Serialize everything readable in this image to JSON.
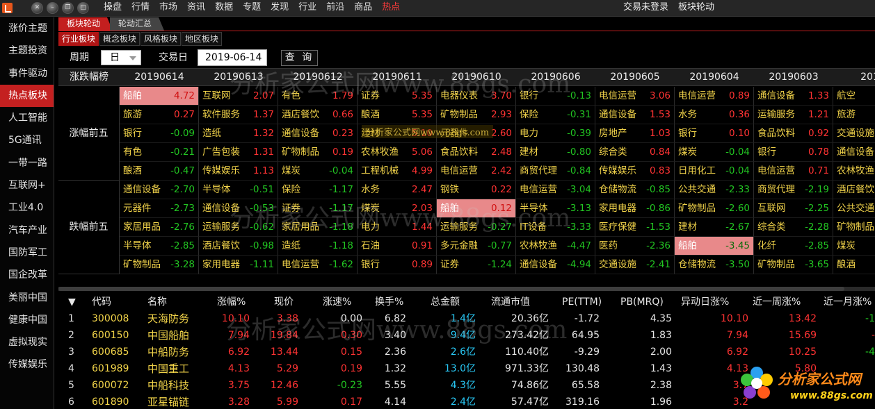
{
  "topbar": {
    "menu": [
      "操盘",
      "行情",
      "市场",
      "资讯",
      "数据",
      "专题",
      "发现",
      "行业",
      "前沿",
      "商品",
      "热点"
    ],
    "active_menu": "热点",
    "login_status": "交易未登录",
    "window_title": "板块轮动",
    "window_controls": [
      "close-icon",
      "minimize-icon",
      "restore-icon",
      "maximize-icon"
    ]
  },
  "sidebar": {
    "items": [
      "涨价主题",
      "主题投资",
      "事件驱动",
      "热点板块",
      "人工智能",
      "5G通讯",
      "一带一路",
      "互联网+",
      "工业4.0",
      "汽车产业",
      "国防军工",
      "国企改革",
      "美丽中国",
      "健康中国",
      "虚拟现实",
      "传媒娱乐"
    ],
    "active": "热点板块"
  },
  "tabs_primary": [
    "板块轮动",
    "轮动汇总"
  ],
  "tabs_secondary": [
    "行业板块",
    "概念板块",
    "风格板块",
    "地区板块"
  ],
  "filters": {
    "period_label": "周期",
    "period_value": "日",
    "date_label": "交易日",
    "date_value": "2019-06-14",
    "query_label": "查 询"
  },
  "rotation": {
    "header_label": "涨跌幅榜",
    "dates": [
      "20190614",
      "20190613",
      "20190612",
      "20190611",
      "20190610",
      "20190606",
      "20190605",
      "20190604",
      "20190603",
      "2019"
    ],
    "groups": [
      "涨幅前五",
      "跌幅前五"
    ],
    "highlight_name": "船舶",
    "rows": [
      [
        [
          "船舶",
          "4.72"
        ],
        [
          "互联网",
          "2.07"
        ],
        [
          "有色",
          "1.79"
        ],
        [
          "证券",
          "5.35"
        ],
        [
          "电器仪表",
          "3.70"
        ],
        [
          "银行",
          "-0.13"
        ],
        [
          "电信运营",
          "3.06"
        ],
        [
          "电信运营",
          "0.89"
        ],
        [
          "通信设备",
          "1.33"
        ],
        [
          "航空",
          ""
        ]
      ],
      [
        [
          "旅游",
          "0.27"
        ],
        [
          "软件服务",
          "1.37"
        ],
        [
          "酒店餐饮",
          "0.66"
        ],
        [
          "酿酒",
          "5.35"
        ],
        [
          "矿物制品",
          "2.93"
        ],
        [
          "保险",
          "-0.31"
        ],
        [
          "通信设备",
          "1.53"
        ],
        [
          "水务",
          "0.36"
        ],
        [
          "运输服务",
          "1.21"
        ],
        [
          "旅游",
          ""
        ]
      ],
      [
        [
          "银行",
          "-0.09"
        ],
        [
          "造纸",
          "1.32"
        ],
        [
          "通信设备",
          "0.23"
        ],
        [
          "建材",
          "5.10"
        ],
        [
          "元器件",
          "2.60"
        ],
        [
          "电力",
          "-0.39"
        ],
        [
          "房地产",
          "1.03"
        ],
        [
          "银行",
          "0.10"
        ],
        [
          "食品饮料",
          "0.92"
        ],
        [
          "交通设施",
          ""
        ]
      ],
      [
        [
          "有色",
          "-0.21"
        ],
        [
          "广告包装",
          "1.31"
        ],
        [
          "矿物制品",
          "0.19"
        ],
        [
          "农林牧渔",
          "5.06"
        ],
        [
          "食品饮料",
          "2.48"
        ],
        [
          "建材",
          "-0.80"
        ],
        [
          "综合类",
          "0.84"
        ],
        [
          "煤炭",
          "-0.04"
        ],
        [
          "银行",
          "0.78"
        ],
        [
          "通信设备",
          ""
        ]
      ],
      [
        [
          "酿酒",
          "-0.47"
        ],
        [
          "传媒娱乐",
          "1.13"
        ],
        [
          "煤炭",
          "-0.04"
        ],
        [
          "工程机械",
          "4.99"
        ],
        [
          "电信运营",
          "2.42"
        ],
        [
          "商贸代理",
          "-0.84"
        ],
        [
          "传媒娱乐",
          "0.83"
        ],
        [
          "日用化工",
          "-0.04"
        ],
        [
          "电信运营",
          "0.71"
        ],
        [
          "农林牧渔",
          ""
        ]
      ],
      [
        [
          "通信设备",
          "-2.70"
        ],
        [
          "半导体",
          "-0.51"
        ],
        [
          "保险",
          "-1.17"
        ],
        [
          "水务",
          "2.47"
        ],
        [
          "钢铁",
          "0.22"
        ],
        [
          "电信运营",
          "-3.04"
        ],
        [
          "仓储物流",
          "-0.85"
        ],
        [
          "公共交通",
          "-2.33"
        ],
        [
          "商贸代理",
          "-2.19"
        ],
        [
          "酒店餐饮",
          ""
        ]
      ],
      [
        [
          "元器件",
          "-2.73"
        ],
        [
          "通信设备",
          "-0.53"
        ],
        [
          "证券",
          "-1.17"
        ],
        [
          "煤炭",
          "2.03"
        ],
        [
          "船舶",
          "0.12"
        ],
        [
          "半导体",
          "-3.13"
        ],
        [
          "家用电器",
          "-0.86"
        ],
        [
          "矿物制品",
          "-2.60"
        ],
        [
          "互联网",
          "-2.25"
        ],
        [
          "公共交通",
          ""
        ]
      ],
      [
        [
          "家居用品",
          "-2.76"
        ],
        [
          "运输服务",
          "-0.62"
        ],
        [
          "家居用品",
          "-1.18"
        ],
        [
          "电力",
          "1.44"
        ],
        [
          "运输服务",
          "-0.27"
        ],
        [
          "IT设备",
          "-3.33"
        ],
        [
          "医疗保健",
          "-1.53"
        ],
        [
          "建材",
          "-2.67"
        ],
        [
          "综合类",
          "-2.28"
        ],
        [
          "矿物制品",
          ""
        ]
      ],
      [
        [
          "半导体",
          "-2.85"
        ],
        [
          "酒店餐饮",
          "-0.98"
        ],
        [
          "造纸",
          "-1.18"
        ],
        [
          "石油",
          "0.91"
        ],
        [
          "多元金融",
          "-0.77"
        ],
        [
          "农林牧渔",
          "-4.47"
        ],
        [
          "医药",
          "-2.36"
        ],
        [
          "船舶",
          "-3.45"
        ],
        [
          "化纤",
          "-2.85"
        ],
        [
          "煤炭",
          ""
        ]
      ],
      [
        [
          "矿物制品",
          "-3.28"
        ],
        [
          "家用电器",
          "-1.11"
        ],
        [
          "电信运营",
          "-1.62"
        ],
        [
          "银行",
          "0.89"
        ],
        [
          "证券",
          "-1.24"
        ],
        [
          "通信设备",
          "-4.94"
        ],
        [
          "交通设施",
          "-2.41"
        ],
        [
          "仓储物流",
          "-3.50"
        ],
        [
          "矿物制品",
          "-3.65"
        ],
        [
          "酿酒",
          ""
        ]
      ]
    ]
  },
  "stock_table": {
    "columns": [
      "代码",
      "名称",
      "涨幅%",
      "现价",
      "涨速%",
      "换手%",
      "总金额",
      "流通市值",
      "PE(TTM)",
      "PB(MRQ)",
      "异动日涨%",
      "近一周涨%",
      "近一月涨%"
    ],
    "rows": [
      [
        "1",
        "300008",
        "天海防务",
        "10.10",
        "3.38",
        "0.00",
        "6.82",
        "1.4亿",
        "20.36亿",
        "-1.72",
        "4.35",
        "10.10",
        "13.42",
        "-1"
      ],
      [
        "2",
        "600150",
        "中国船舶",
        "7.94",
        "19.84",
        "0.30",
        "3.40",
        "9.4亿",
        "273.42亿",
        "64.95",
        "1.83",
        "7.94",
        "15.69",
        "-"
      ],
      [
        "3",
        "600685",
        "中船防务",
        "6.92",
        "13.44",
        "0.15",
        "2.36",
        "2.6亿",
        "110.40亿",
        "-9.29",
        "2.00",
        "6.92",
        "10.25",
        "-4"
      ],
      [
        "4",
        "601989",
        "中国重工",
        "4.13",
        "5.29",
        "0.19",
        "1.32",
        "13.0亿",
        "971.33亿",
        "130.48",
        "1.43",
        "4.13",
        "5.80",
        ""
      ],
      [
        "5",
        "600072",
        "中船科技",
        "3.75",
        "12.46",
        "-0.23",
        "5.55",
        "4.3亿",
        "74.86亿",
        "65.58",
        "2.38",
        "3.7",
        ""
      ],
      [
        "6",
        "601890",
        "亚星锚链",
        "3.28",
        "5.99",
        "0.17",
        "4.14",
        "2.4亿",
        "57.47亿",
        "319.16",
        "1.96",
        "3.2",
        ""
      ]
    ]
  },
  "watermark": {
    "text": "分析家公式网www.88gs.com",
    "logo_text": "分析家公式网",
    "logo_url": "www.88gs.com",
    "small_text": "分析家公式网www.88gs.com"
  },
  "colors": {
    "up": "#ff3333",
    "down": "#22c522",
    "highlight": "#e8898a",
    "accent": "#c31f1f"
  }
}
